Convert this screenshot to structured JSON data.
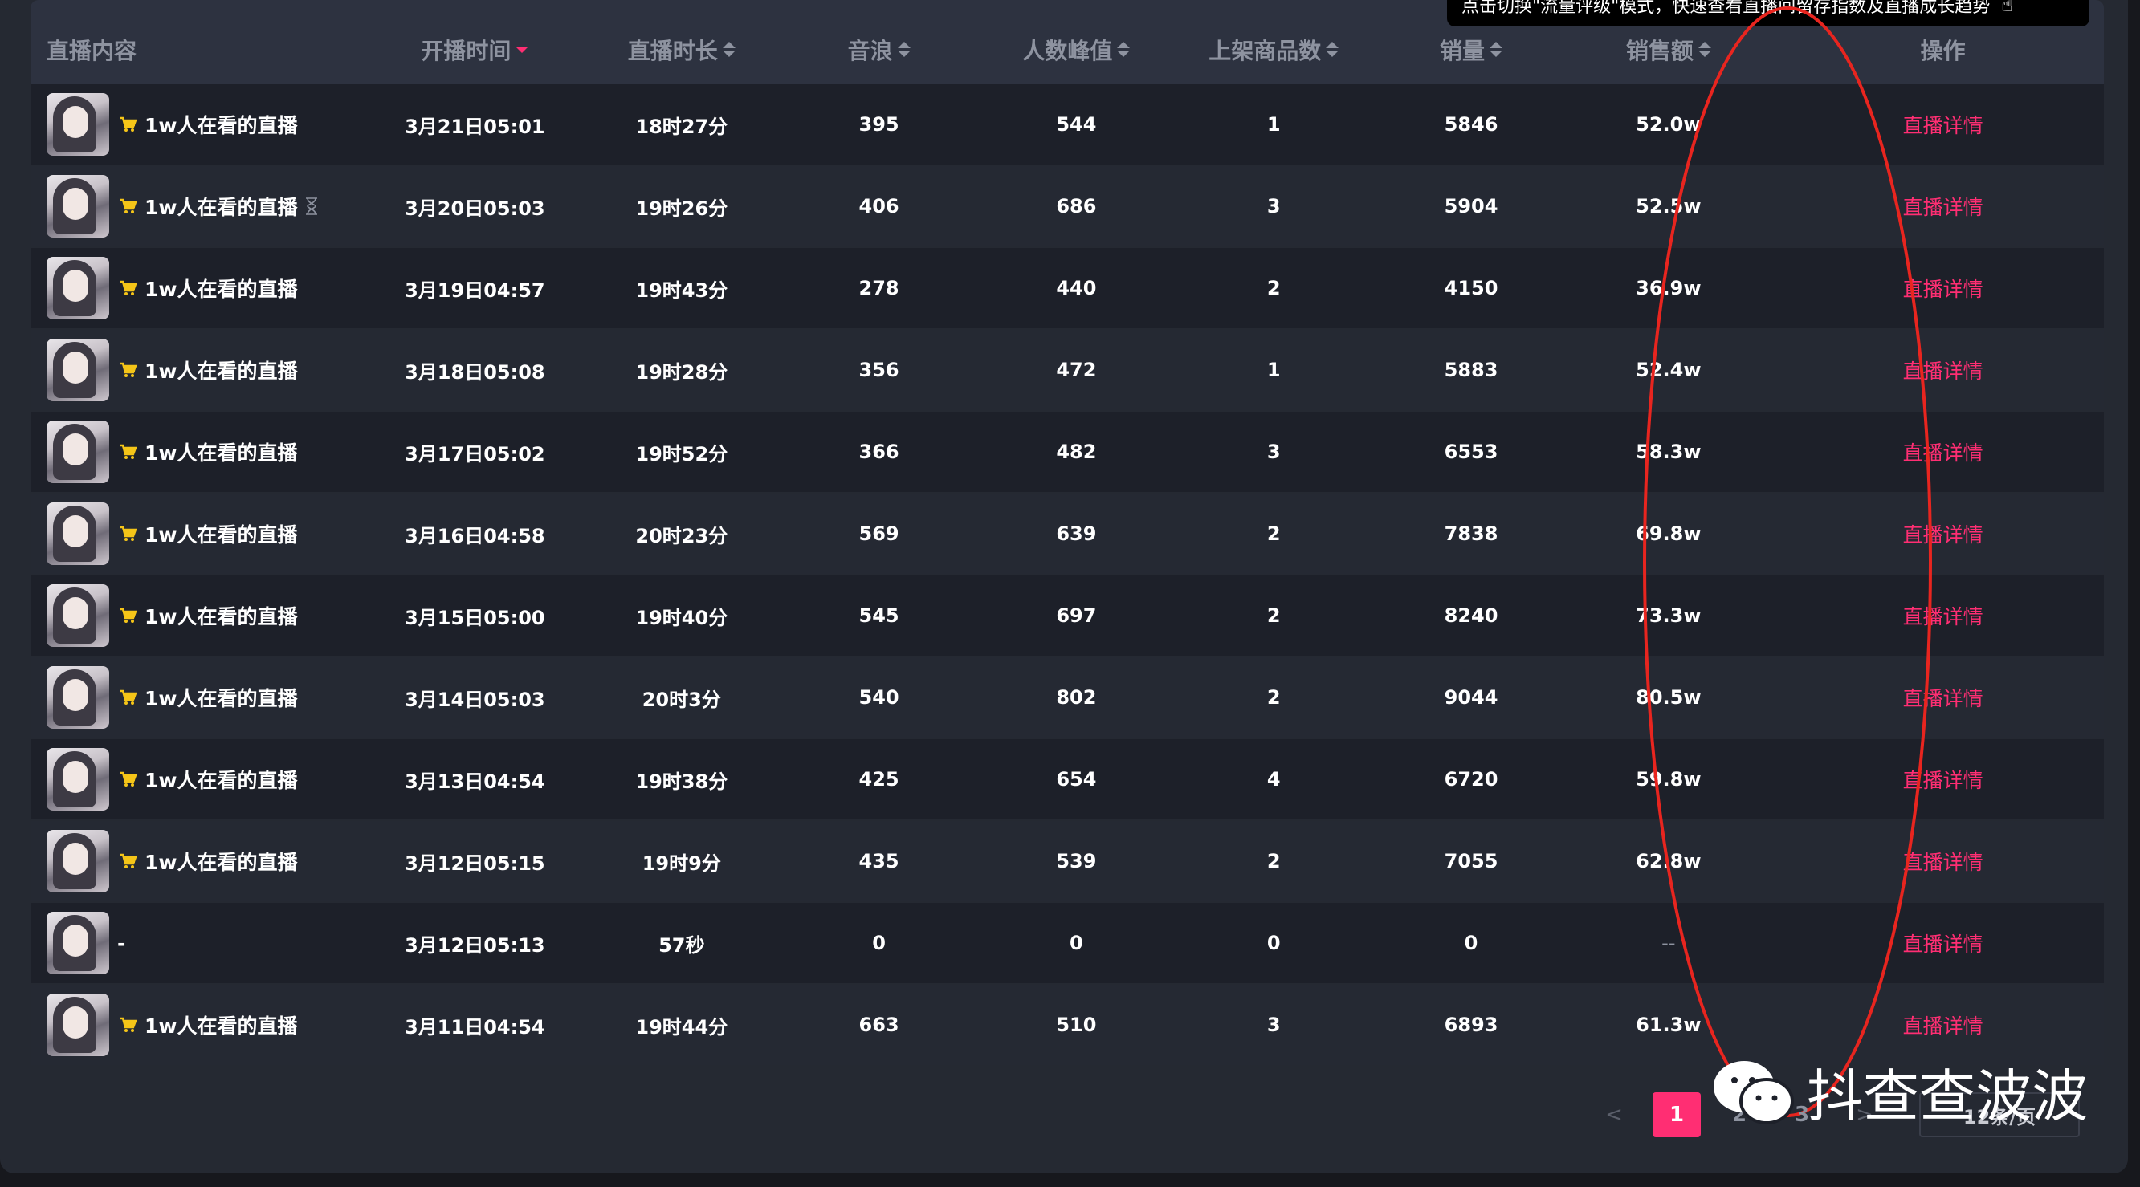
{
  "tooltip": {
    "text": "点击切换\"流量评级\"模式，快速查看直播间留存指数及直播成长趋势"
  },
  "columns": [
    "直播内容",
    "开播时间",
    "直播时长",
    "音浪",
    "人数峰值",
    "上架商品数",
    "销量",
    "销售额",
    "操作"
  ],
  "rows": [
    {
      "title": "1w人在看的直播",
      "cart": true,
      "time": "3月21日05:01",
      "duration": "18时27分",
      "yinlang": "395",
      "peak": "544",
      "items": "1",
      "sales": "5846",
      "revenue": "52.0w",
      "action": "直播详情"
    },
    {
      "title": "1w人在看的直播",
      "cart": true,
      "hourglass": true,
      "time": "3月20日05:03",
      "duration": "19时26分",
      "yinlang": "406",
      "peak": "686",
      "items": "3",
      "sales": "5904",
      "revenue": "52.5w",
      "action": "直播详情"
    },
    {
      "title": "1w人在看的直播",
      "cart": true,
      "time": "3月19日04:57",
      "duration": "19时43分",
      "yinlang": "278",
      "peak": "440",
      "items": "2",
      "sales": "4150",
      "revenue": "36.9w",
      "action": "直播详情"
    },
    {
      "title": "1w人在看的直播",
      "cart": true,
      "time": "3月18日05:08",
      "duration": "19时28分",
      "yinlang": "356",
      "peak": "472",
      "items": "1",
      "sales": "5883",
      "revenue": "52.4w",
      "action": "直播详情"
    },
    {
      "title": "1w人在看的直播",
      "cart": true,
      "time": "3月17日05:02",
      "duration": "19时52分",
      "yinlang": "366",
      "peak": "482",
      "items": "3",
      "sales": "6553",
      "revenue": "58.3w",
      "action": "直播详情"
    },
    {
      "title": "1w人在看的直播",
      "cart": true,
      "time": "3月16日04:58",
      "duration": "20时23分",
      "yinlang": "569",
      "peak": "639",
      "items": "2",
      "sales": "7838",
      "revenue": "69.8w",
      "action": "直播详情"
    },
    {
      "title": "1w人在看的直播",
      "cart": true,
      "time": "3月15日05:00",
      "duration": "19时40分",
      "yinlang": "545",
      "peak": "697",
      "items": "2",
      "sales": "8240",
      "revenue": "73.3w",
      "action": "直播详情"
    },
    {
      "title": "1w人在看的直播",
      "cart": true,
      "time": "3月14日05:03",
      "duration": "20时3分",
      "yinlang": "540",
      "peak": "802",
      "items": "2",
      "sales": "9044",
      "revenue": "80.5w",
      "action": "直播详情"
    },
    {
      "title": "1w人在看的直播",
      "cart": true,
      "time": "3月13日04:54",
      "duration": "19时38分",
      "yinlang": "425",
      "peak": "654",
      "items": "4",
      "sales": "6720",
      "revenue": "59.8w",
      "action": "直播详情"
    },
    {
      "title": "1w人在看的直播",
      "cart": true,
      "time": "3月12日05:15",
      "duration": "19时9分",
      "yinlang": "435",
      "peak": "539",
      "items": "2",
      "sales": "7055",
      "revenue": "62.8w",
      "action": "直播详情"
    },
    {
      "title": "-",
      "cart": false,
      "time": "3月12日05:13",
      "duration": "57秒",
      "yinlang": "0",
      "peak": "0",
      "items": "0",
      "sales": "0",
      "revenue": "--",
      "action": "直播详情"
    },
    {
      "title": "1w人在看的直播",
      "cart": true,
      "time": "3月11日04:54",
      "duration": "19时44分",
      "yinlang": "663",
      "peak": "510",
      "items": "3",
      "sales": "6893",
      "revenue": "61.3w",
      "action": "直播详情"
    }
  ],
  "pagination": {
    "prev": "<",
    "pages": [
      "1",
      "2",
      "3"
    ],
    "current": "1",
    "next": ">",
    "page_size": "12条/页"
  },
  "watermark": {
    "text": "抖查查波波"
  },
  "colors": {
    "accent": "#ff2e73",
    "annotation": "#e8251f",
    "cart": "#f5c518"
  }
}
